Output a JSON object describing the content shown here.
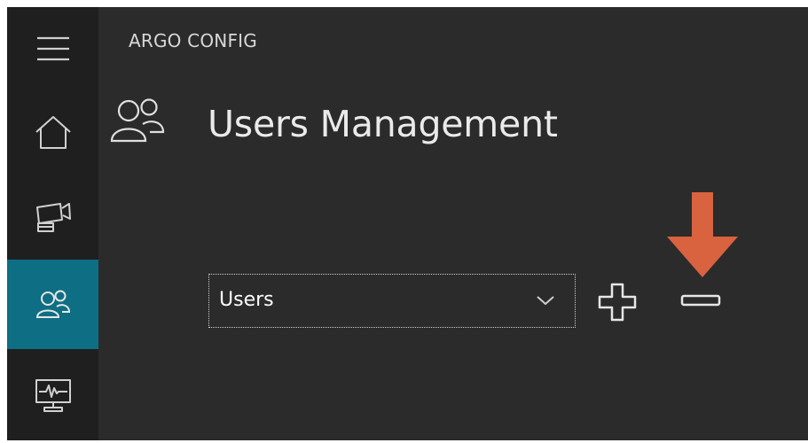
{
  "app": {
    "title": "ARGO CONFIG"
  },
  "sidebar": {
    "items": [
      {
        "name": "menu",
        "icon": "hamburger-icon",
        "active": false
      },
      {
        "name": "home",
        "icon": "home-icon",
        "active": false
      },
      {
        "name": "cameras",
        "icon": "camera-icon",
        "active": false
      },
      {
        "name": "users",
        "icon": "users-icon",
        "active": true
      },
      {
        "name": "monitor",
        "icon": "monitor-icon",
        "active": false
      }
    ]
  },
  "header": {
    "icon": "users-icon",
    "title": "Users Management"
  },
  "users_panel": {
    "select": {
      "value": "Users",
      "icon": "chevron-down-icon"
    },
    "add_icon": "plus-icon",
    "remove_icon": "minus-icon"
  },
  "annotation": {
    "icon": "arrow-down-icon",
    "color": "#d9623f"
  },
  "colors": {
    "background": "#2b2b2b",
    "sidebar": "#1f1f1f",
    "accent": "#0e6e83",
    "text": "#eaeaea"
  }
}
